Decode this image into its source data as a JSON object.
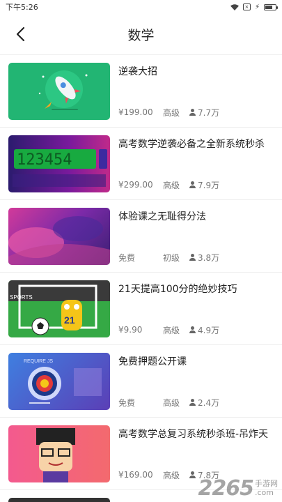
{
  "status": {
    "time": "下午5:26"
  },
  "nav": {
    "title": "数学"
  },
  "courses": [
    {
      "title": "逆袭大招",
      "price": "¥199.00",
      "level": "高级",
      "users": "7.7万"
    },
    {
      "title": "高考数学逆袭必备之全新系统秒杀",
      "price": "¥299.00",
      "level": "高级",
      "users": "7.9万"
    },
    {
      "title": "体验课之无耻得分法",
      "price": "免费",
      "level": "初级",
      "users": "3.8万"
    },
    {
      "title": "21天提高100分的绝妙技巧",
      "price": "¥9.90",
      "level": "高级",
      "users": "4.9万"
    },
    {
      "title": "免费押题公开课",
      "price": "免费",
      "level": "高级",
      "users": "2.4万"
    },
    {
      "title": "高考数学总复习系统秒杀班-吊炸天",
      "price": "¥169.00",
      "level": "高级",
      "users": "7.8万"
    }
  ],
  "thumb_text": {
    "t2": "123454",
    "t4_board": "SPORTS",
    "t4_num": "21",
    "t5": "REQUIRE JS"
  },
  "watermark": {
    "num": "2265",
    "site_cn": "手游网",
    "site_en": ".com"
  }
}
